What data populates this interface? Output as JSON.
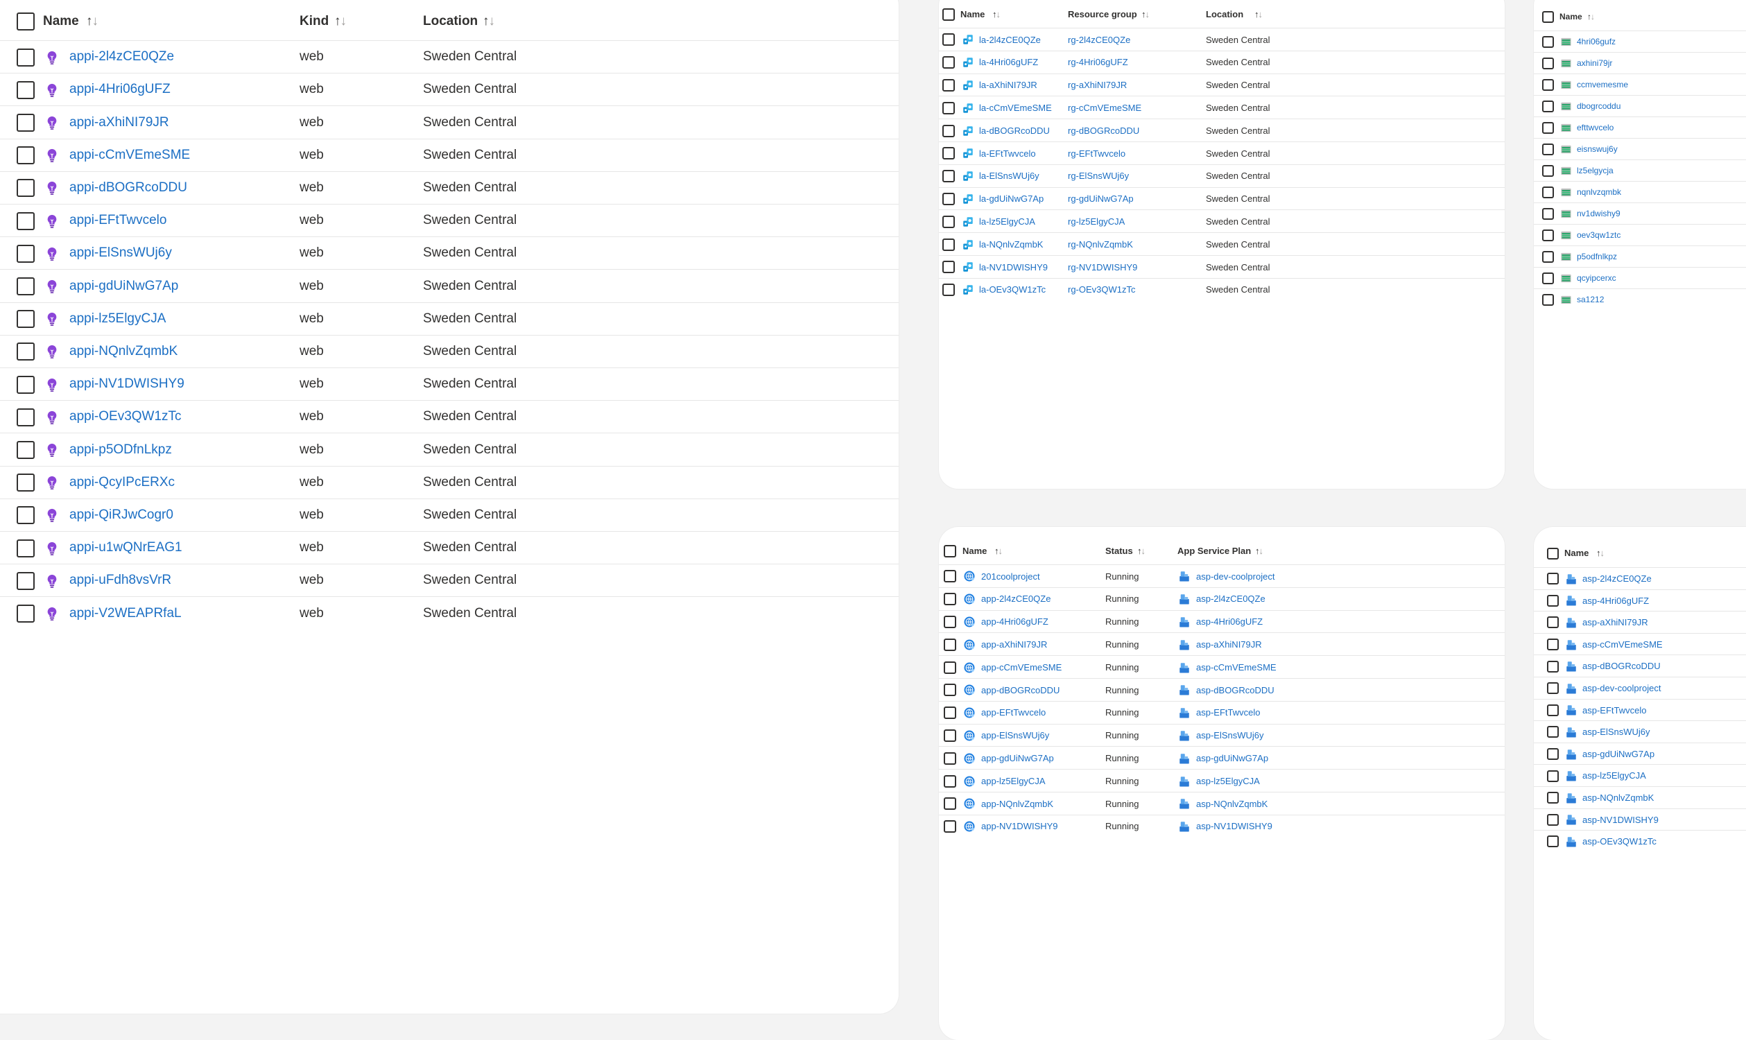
{
  "panel_app_insights": {
    "columns": [
      "Name",
      "Kind",
      "Location"
    ],
    "rows": [
      {
        "name": "appi-2l4zCE0QZe",
        "kind": "web",
        "location": "Sweden Central"
      },
      {
        "name": "appi-4Hri06gUFZ",
        "kind": "web",
        "location": "Sweden Central"
      },
      {
        "name": "appi-aXhiNI79JR",
        "kind": "web",
        "location": "Sweden Central"
      },
      {
        "name": "appi-cCmVEmeSME",
        "kind": "web",
        "location": "Sweden Central"
      },
      {
        "name": "appi-dBOGRcoDDU",
        "kind": "web",
        "location": "Sweden Central"
      },
      {
        "name": "appi-EFtTwvcelo",
        "kind": "web",
        "location": "Sweden Central"
      },
      {
        "name": "appi-ElSnsWUj6y",
        "kind": "web",
        "location": "Sweden Central"
      },
      {
        "name": "appi-gdUiNwG7Ap",
        "kind": "web",
        "location": "Sweden Central"
      },
      {
        "name": "appi-lz5ElgyCJA",
        "kind": "web",
        "location": "Sweden Central"
      },
      {
        "name": "appi-NQnlvZqmbK",
        "kind": "web",
        "location": "Sweden Central"
      },
      {
        "name": "appi-NV1DWISHY9",
        "kind": "web",
        "location": "Sweden Central"
      },
      {
        "name": "appi-OEv3QW1zTc",
        "kind": "web",
        "location": "Sweden Central"
      },
      {
        "name": "appi-p5ODfnLkpz",
        "kind": "web",
        "location": "Sweden Central"
      },
      {
        "name": "appi-QcyIPcERXc",
        "kind": "web",
        "location": "Sweden Central"
      },
      {
        "name": "appi-QiRJwCogr0",
        "kind": "web",
        "location": "Sweden Central"
      },
      {
        "name": "appi-u1wQNrEAG1",
        "kind": "web",
        "location": "Sweden Central"
      },
      {
        "name": "appi-uFdh8vsVrR",
        "kind": "web",
        "location": "Sweden Central"
      },
      {
        "name": "appi-V2WEAPRfaL",
        "kind": "web",
        "location": "Sweden Central"
      }
    ]
  },
  "panel_logic_apps": {
    "columns": [
      "Name",
      "Resource group",
      "Location"
    ],
    "rows": [
      {
        "name": "la-2l4zCE0QZe",
        "group": "rg-2l4zCE0QZe",
        "location": "Sweden Central"
      },
      {
        "name": "la-4Hri06gUFZ",
        "group": "rg-4Hri06gUFZ",
        "location": "Sweden Central"
      },
      {
        "name": "la-aXhiNI79JR",
        "group": "rg-aXhiNI79JR",
        "location": "Sweden Central"
      },
      {
        "name": "la-cCmVEmeSME",
        "group": "rg-cCmVEmeSME",
        "location": "Sweden Central"
      },
      {
        "name": "la-dBOGRcoDDU",
        "group": "rg-dBOGRcoDDU",
        "location": "Sweden Central"
      },
      {
        "name": "la-EFtTwvcelo",
        "group": "rg-EFtTwvcelo",
        "location": "Sweden Central"
      },
      {
        "name": "la-ElSnsWUj6y",
        "group": "rg-ElSnsWUj6y",
        "location": "Sweden Central"
      },
      {
        "name": "la-gdUiNwG7Ap",
        "group": "rg-gdUiNwG7Ap",
        "location": "Sweden Central"
      },
      {
        "name": "la-lz5ElgyCJA",
        "group": "rg-lz5ElgyCJA",
        "location": "Sweden Central"
      },
      {
        "name": "la-NQnlvZqmbK",
        "group": "rg-NQnlvZqmbK",
        "location": "Sweden Central"
      },
      {
        "name": "la-NV1DWISHY9",
        "group": "rg-NV1DWISHY9",
        "location": "Sweden Central"
      },
      {
        "name": "la-OEv3QW1zTc",
        "group": "rg-OEv3QW1zTc",
        "location": "Sweden Central"
      }
    ]
  },
  "panel_storage": {
    "columns": [
      "Name"
    ],
    "rows": [
      {
        "name": "4hri06gufz"
      },
      {
        "name": "axhini79jr"
      },
      {
        "name": "ccmvemesme"
      },
      {
        "name": "dbogrcoddu"
      },
      {
        "name": "efttwvcelo"
      },
      {
        "name": "eisnswuj6y"
      },
      {
        "name": "lz5elgycja"
      },
      {
        "name": "nqnlvzqmbk"
      },
      {
        "name": "nv1dwishy9"
      },
      {
        "name": "oev3qw1ztc"
      },
      {
        "name": "p5odfnlkpz"
      },
      {
        "name": "qcyipcerxc"
      },
      {
        "name": "sa1212"
      }
    ]
  },
  "panel_web_apps": {
    "columns": [
      "Name",
      "Status",
      "App Service Plan"
    ],
    "rows": [
      {
        "name": "201coolproject",
        "status": "Running",
        "plan": "asp-dev-coolproject"
      },
      {
        "name": "app-2l4zCE0QZe",
        "status": "Running",
        "plan": "asp-2l4zCE0QZe"
      },
      {
        "name": "app-4Hri06gUFZ",
        "status": "Running",
        "plan": "asp-4Hri06gUFZ"
      },
      {
        "name": "app-aXhiNI79JR",
        "status": "Running",
        "plan": "asp-aXhiNI79JR"
      },
      {
        "name": "app-cCmVEmeSME",
        "status": "Running",
        "plan": "asp-cCmVEmeSME"
      },
      {
        "name": "app-dBOGRcoDDU",
        "status": "Running",
        "plan": "asp-dBOGRcoDDU"
      },
      {
        "name": "app-EFtTwvcelo",
        "status": "Running",
        "plan": "asp-EFtTwvcelo"
      },
      {
        "name": "app-ElSnsWUj6y",
        "status": "Running",
        "plan": "asp-ElSnsWUj6y"
      },
      {
        "name": "app-gdUiNwG7Ap",
        "status": "Running",
        "plan": "asp-gdUiNwG7Ap"
      },
      {
        "name": "app-lz5ElgyCJA",
        "status": "Running",
        "plan": "asp-lz5ElgyCJA"
      },
      {
        "name": "app-NQnlvZqmbK",
        "status": "Running",
        "plan": "asp-NQnlvZqmbK"
      },
      {
        "name": "app-NV1DWISHY9",
        "status": "Running",
        "plan": "asp-NV1DWISHY9"
      }
    ]
  },
  "panel_service_plans": {
    "columns": [
      "Name"
    ],
    "rows": [
      {
        "name": "asp-2l4zCE0QZe"
      },
      {
        "name": "asp-4Hri06gUFZ"
      },
      {
        "name": "asp-aXhiNI79JR"
      },
      {
        "name": "asp-cCmVEmeSME"
      },
      {
        "name": "asp-dBOGRcoDDU"
      },
      {
        "name": "asp-dev-coolproject"
      },
      {
        "name": "asp-EFtTwvcelo"
      },
      {
        "name": "asp-ElSnsWUj6y"
      },
      {
        "name": "asp-gdUiNwG7Ap"
      },
      {
        "name": "asp-lz5ElgyCJA"
      },
      {
        "name": "asp-NQnlvZqmbK"
      },
      {
        "name": "asp-NV1DWISHY9"
      },
      {
        "name": "asp-OEv3QW1zTc"
      }
    ]
  },
  "icons": {
    "app_insights": "lightbulb-icon",
    "logic_app": "logic-app-icon",
    "storage": "storage-account-icon",
    "web_app": "globe-icon",
    "service_plan": "app-service-plan-icon"
  },
  "colors": {
    "link": "#1c6fc4",
    "app_insights_icon": "#8b45d8",
    "logic_app_icon": "#1493d6",
    "storage_icon": "#2aa56a",
    "web_app_icon": "#1f7fe0",
    "service_plan_icon": "#2b7bd6"
  }
}
